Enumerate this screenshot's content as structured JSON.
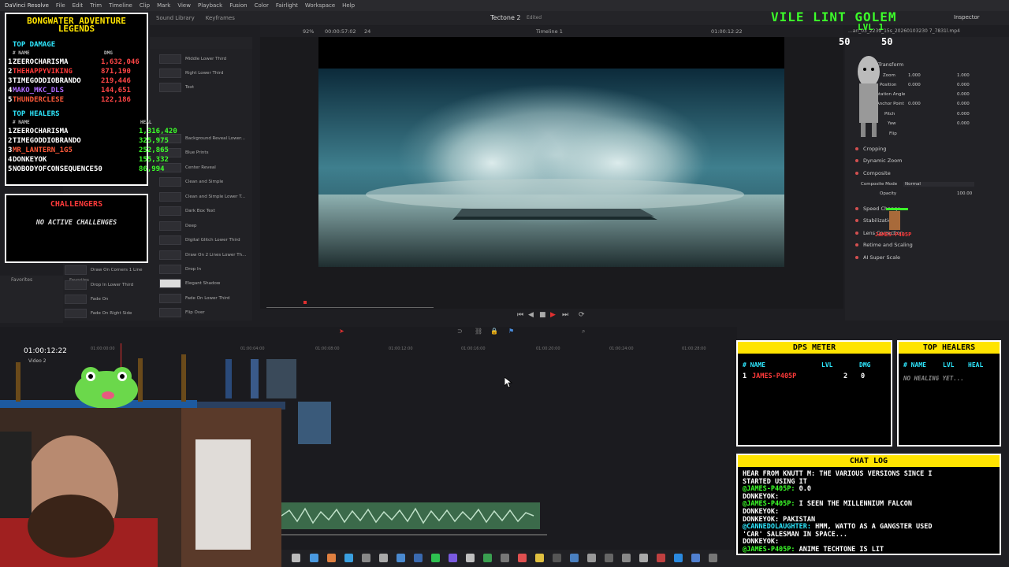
{
  "menubar": {
    "app": "DaVinci Resolve",
    "items": [
      "File",
      "Edit",
      "Trim",
      "Timeline",
      "Clip",
      "Mark",
      "View",
      "Playback",
      "Fusion",
      "Color",
      "Fairlight",
      "Workspace",
      "Help"
    ]
  },
  "topbar": {
    "sound_library": "Sound Library",
    "keyframes": "Keyframes",
    "project": "Tectone 2",
    "edited": "Edited",
    "inspector": "Inspector"
  },
  "viewer_toolbar": {
    "zoom": "92%",
    "timecode_left": "00:00:57:02",
    "fps": "24",
    "timeline_name": "Timeline 1",
    "timecode_right": "01:00:12:22",
    "clip_name": "...an_03_2239_15s_20260103230 7_7831l.mp4"
  },
  "effects": {
    "left_col": [
      "Draw On Corners 1 Line",
      "Drop In Lower Third",
      "Fade On",
      "Fade On Right Side"
    ],
    "right_col": [
      "Middle Lower Third",
      "Right Lower Third",
      "Text",
      "Background Reveal Lower...",
      "Blue Prints",
      "Center Reveal",
      "Clean and Simple",
      "Clean and Simple Lower T...",
      "Dark Box Text",
      "Deep",
      "Digital Glitch Lower Third",
      "Draw On 2 Lines Lower Th...",
      "Drop In",
      "Elegant Shadow",
      "Fade On Lower Third",
      "Flip Over"
    ],
    "favorites": "Favorites"
  },
  "inspector": {
    "transform_label": "Transform",
    "zoom_label": "Zoom",
    "zoom_x": "1.000",
    "zoom_y": "1.000",
    "position_label": "Position",
    "position_x": "0.000",
    "position_y": "0.000",
    "angle_label": "Rotation Angle",
    "angle_value": "0.000",
    "anchor_label": "Anchor Point",
    "anchor_x": "0.000",
    "anchor_y": "0.000",
    "pitch_label": "Pitch",
    "pitch_value": "0.000",
    "yaw_label": "Yaw",
    "yaw_value": "0.000",
    "flip_label": "Flip",
    "sections": [
      "Cropping",
      "Dynamic Zoom",
      "Composite"
    ],
    "composite_mode_label": "Composite Mode",
    "composite_mode_value": "Normal",
    "opacity_label": "Opacity",
    "opacity_value": "100.00",
    "more_sections": [
      "Speed Change",
      "Stabilization",
      "Lens Correction",
      "Retime and Scaling",
      "AI Super Scale"
    ]
  },
  "timeline": {
    "timecode": "01:00:12:22",
    "track_label": "Video 2",
    "ruler": [
      "01:00:00:00",
      "01:00:04:00",
      "01:00:08:00",
      "01:00:12:00",
      "01:00:16:00",
      "01:00:20:00",
      "01:00:24:00",
      "01:00:28:00",
      "01:00:32:00"
    ]
  },
  "overlay": {
    "game_title": "BONGWATER ADVENTURE LEGENDS",
    "top_damage": "TOP DAMAGE",
    "col_name": "# NAME",
    "col_dmg": "DMG",
    "damage": [
      {
        "rank": "1",
        "name": "ZEEROCHARISMA",
        "value": "1,632,046",
        "color": "#ffffff",
        "vcolor": "#ff4646"
      },
      {
        "rank": "2",
        "name": "THEHAPPYVIKING",
        "value": "871,190",
        "color": "#ff3a3a",
        "vcolor": "#ff4646"
      },
      {
        "rank": "3",
        "name": "TIMEGODDIOBRANDO",
        "value": "219,446",
        "color": "#ffffff",
        "vcolor": "#ff4646"
      },
      {
        "rank": "4",
        "name": "MAKO_MKC_DLS",
        "value": "144,651",
        "color": "#b06cff",
        "vcolor": "#ff4646"
      },
      {
        "rank": "5",
        "name": "THUNDERCLESE",
        "value": "122,186",
        "color": "#ff5a3a",
        "vcolor": "#ff4646"
      }
    ],
    "top_healers": "TOP HEALERS",
    "col_heal": "HEAL",
    "healers": [
      {
        "rank": "1",
        "name": "ZEEROCHARISMA",
        "value": "1,316,420",
        "color": "#ffffff"
      },
      {
        "rank": "2",
        "name": "TIMEGODDIOBRANDO",
        "value": "325,975",
        "color": "#ffffff"
      },
      {
        "rank": "3",
        "name": "MR_LANTERN_1G5",
        "value": "252,865",
        "color": "#ff5a3a"
      },
      {
        "rank": "4",
        "name": "DONKEYOK",
        "value": "155,332",
        "color": "#ffffff"
      },
      {
        "rank": "5",
        "name": "NOBODYOFCONSEQUENCE50",
        "value": "86,994",
        "color": "#ffffff"
      }
    ],
    "heal_color": "#3cff2a",
    "challengers_title": "CHALLENGERS",
    "challengers_empty": "NO ACTIVE CHALLENGES",
    "boss_name": "VILE LINT GOLEM",
    "boss_level": "LVL 1",
    "boss_hp_left": "50",
    "boss_hp_right": "50",
    "player_tag": "JAMES-P405P",
    "dps_title": "DPS METER",
    "dps_cols": [
      "# NAME",
      "LVL",
      "DMG"
    ],
    "dps_rows": [
      {
        "rank": "1",
        "name": "JAMES-P405P",
        "lvl": "2",
        "dmg": "0"
      }
    ],
    "healers_panel_title": "TOP HEALERS",
    "healers_panel_cols": [
      "# NAME",
      "LVL",
      "HEAL"
    ],
    "healers_panel_empty": "NO HEALING YET...",
    "chat_title": "CHAT LOG",
    "chat": [
      {
        "user": "",
        "text": "HEAR FROM KNUTT M: THE VARIOUS VERSIONS SINCE I",
        "ucolor": "#ffffff"
      },
      {
        "user": "",
        "text": "STARTED USING IT",
        "ucolor": "#ffffff"
      },
      {
        "user": "@JAMES-P405P:",
        "text": " 0.0",
        "ucolor": "#3cff2a"
      },
      {
        "user": "DONKEYOK:",
        "text": "",
        "ucolor": "#ffffff"
      },
      {
        "user": "@JAMES-P405P:",
        "text": " I SEEN THE MILLENNIUM FALCON",
        "ucolor": "#3cff2a"
      },
      {
        "user": "DONKEYOK:",
        "text": "",
        "ucolor": "#ffffff"
      },
      {
        "user": "DONKEYOK:",
        "text": " PAKISTAN",
        "ucolor": "#ffffff"
      },
      {
        "user": "@CANNEDOLAUGHTER:",
        "text": " HMM, WATTO AS A GANGSTER USED",
        "ucolor": "#2ee8ff"
      },
      {
        "user": "",
        "text": "'CAR' SALESMAN IN SPACE...",
        "ucolor": "#ffffff"
      },
      {
        "user": "DONKEYOK:",
        "text": "",
        "ucolor": "#ffffff"
      },
      {
        "user": "@JAMES-P405P:",
        "text": " ANIME TECHTONE IS LIT",
        "ucolor": "#3cff2a"
      }
    ]
  },
  "colors": {
    "accent_yellow": "#ffe400",
    "accent_green": "#3cff2a",
    "accent_cyan": "#2ee8ff",
    "playhead_red": "#e03030"
  }
}
